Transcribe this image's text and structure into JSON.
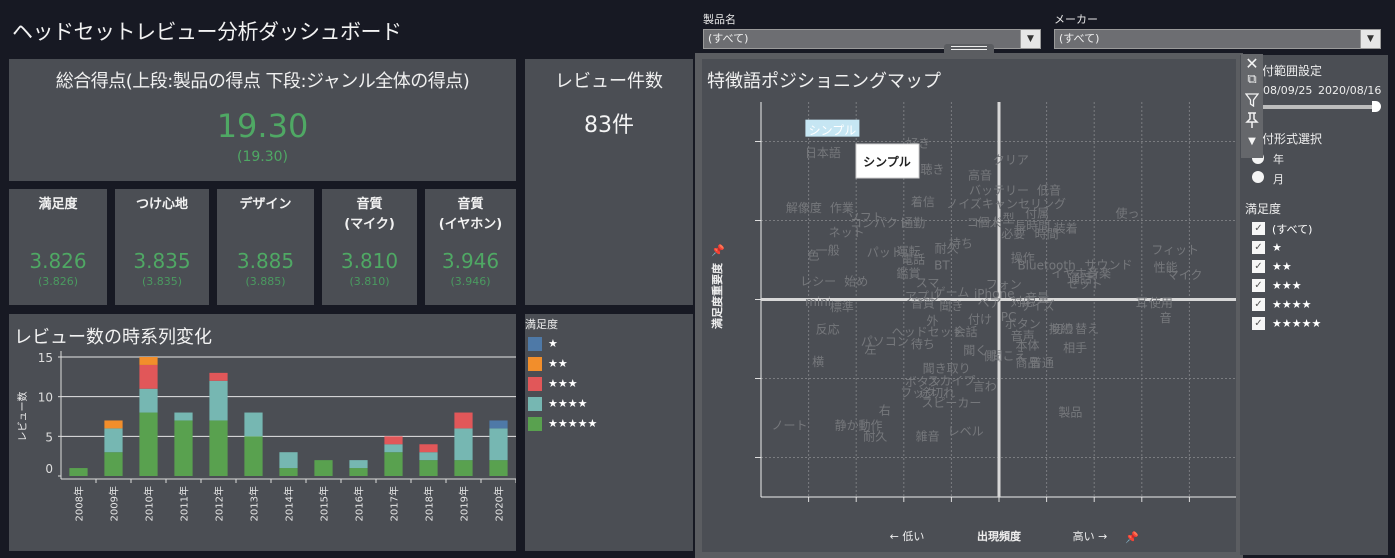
{
  "app": {
    "title": "ヘッドセットレビュー分析ダッシュボード"
  },
  "total_score": {
    "title": "総合得点(上段:製品の得点 下段:ジャンル全体の得点)",
    "product_score": "19.30",
    "genre_score": "(19.30)"
  },
  "review_count": {
    "title": "レビュー件数",
    "value": "83件"
  },
  "metrics": [
    {
      "label": "満足度",
      "value": "3.826",
      "genre": "(3.826)"
    },
    {
      "label": "つけ心地",
      "value": "3.835",
      "genre": "(3.835)"
    },
    {
      "label": "デザイン",
      "value": "3.885",
      "genre": "(3.885)"
    },
    {
      "label": "音質\n(マイク)",
      "value": "3.810",
      "genre": "(3.810)"
    },
    {
      "label": "音質\n(イヤホン)",
      "value": "3.946",
      "genre": "(3.946)"
    }
  ],
  "filters": {
    "product": {
      "label": "製品名",
      "value": "(すべて)"
    },
    "maker": {
      "label": "メーカー",
      "value": "(すべて)"
    }
  },
  "colors": {
    "star1": "#4e79a7",
    "star2": "#f28e2b",
    "star3": "#e15759",
    "star4": "#76b7b2",
    "star5": "#59a14f",
    "score_green": "#4fa864"
  },
  "legend": {
    "title": "満足度",
    "items": [
      {
        "label": "★",
        "key": "star1"
      },
      {
        "label": "★★",
        "key": "star2"
      },
      {
        "label": "★★★",
        "key": "star3"
      },
      {
        "label": "★★★★",
        "key": "star4"
      },
      {
        "label": "★★★★★",
        "key": "star5"
      }
    ]
  },
  "chart_data": [
    {
      "type": "bar",
      "stacked": true,
      "title": "レビュー数の時系列変化",
      "xlabel": "",
      "ylabel": "レビュー数",
      "ylim": [
        0,
        15
      ],
      "yticks": [
        0,
        5,
        10,
        15
      ],
      "grid": true,
      "categories": [
        "2008年",
        "2009年",
        "2010年",
        "2011年",
        "2012年",
        "2013年",
        "2014年",
        "2015年",
        "2016年",
        "2017年",
        "2018年",
        "2019年",
        "2020年"
      ],
      "series": [
        {
          "name": "★★★★★",
          "key": "star5",
          "values": [
            1,
            3,
            8,
            7,
            7,
            5,
            1,
            2,
            1,
            3,
            2,
            2,
            2
          ]
        },
        {
          "name": "★★★★",
          "key": "star4",
          "values": [
            0,
            3,
            3,
            1,
            5,
            3,
            2,
            0,
            1,
            1,
            1,
            4,
            4
          ]
        },
        {
          "name": "★★★",
          "key": "star3",
          "values": [
            0,
            0,
            3,
            0,
            1,
            0,
            0,
            0,
            0,
            1,
            1,
            2,
            0
          ]
        },
        {
          "name": "★★",
          "key": "star2",
          "values": [
            0,
            1,
            1,
            0,
            0,
            0,
            0,
            0,
            0,
            0,
            0,
            0,
            0
          ]
        },
        {
          "name": "★",
          "key": "star1",
          "values": [
            0,
            0,
            0,
            0,
            0,
            0,
            0,
            0,
            0,
            0,
            0,
            0,
            1
          ]
        }
      ],
      "legend": "right"
    },
    {
      "type": "scatter",
      "title": "特徴語ポジショニングマップ",
      "xlabel": "出現頻度",
      "xlabel_low": "← 低い",
      "xlabel_high": "高い →",
      "ylabel": "満足度重要度",
      "xlim": [
        -5,
        5
      ],
      "ylim": [
        -2.5,
        2.5
      ],
      "grid": true,
      "highlighted": "シンプル",
      "tooltip": "シンプル",
      "points": [
        {
          "w": "シンプル",
          "x": -3.5,
          "y": 2.15
        },
        {
          "w": "好き",
          "x": -1.7,
          "y": 1.99
        },
        {
          "w": "日本語",
          "x": -3.7,
          "y": 1.87
        },
        {
          "w": "聴き",
          "x": -1.4,
          "y": 1.66
        },
        {
          "w": "クリア",
          "x": 0.25,
          "y": 1.78
        },
        {
          "w": "高音",
          "x": -0.4,
          "y": 1.58
        },
        {
          "w": "バッテリー",
          "x": 0.0,
          "y": 1.39
        },
        {
          "w": "低音",
          "x": 1.05,
          "y": 1.39
        },
        {
          "w": "着信",
          "x": -1.6,
          "y": 1.25
        },
        {
          "w": "ノイズキャンセリング",
          "x": 0.15,
          "y": 1.22
        },
        {
          "w": "解像度",
          "x": -4.1,
          "y": 1.17
        },
        {
          "w": "作業",
          "x": -3.3,
          "y": 1.17
        },
        {
          "w": "付属",
          "x": 0.8,
          "y": 1.1
        },
        {
          "w": "使っ",
          "x": 2.7,
          "y": 1.1
        },
        {
          "w": "ソフト",
          "x": -2.8,
          "y": 1.05
        },
        {
          "w": "コンパクト",
          "x": -2.5,
          "y": 0.98
        },
        {
          "w": "通勤",
          "x": -1.8,
          "y": 0.98
        },
        {
          "w": "コード",
          "x": -0.3,
          "y": 0.99
        },
        {
          "w": "個人",
          "x": -0.2,
          "y": 0.99
        },
        {
          "w": "型",
          "x": 0.2,
          "y": 1.04
        },
        {
          "w": "長時間",
          "x": 0.7,
          "y": 0.94
        },
        {
          "w": "装着",
          "x": 1.4,
          "y": 0.91
        },
        {
          "w": "必要",
          "x": 0.3,
          "y": 0.84
        },
        {
          "w": "時間",
          "x": 1.0,
          "y": 0.84
        },
        {
          "w": "ネット",
          "x": -3.2,
          "y": 0.86
        },
        {
          "w": "一般",
          "x": -3.6,
          "y": 0.63
        },
        {
          "w": "色",
          "x": -3.9,
          "y": 0.57
        },
        {
          "w": "パッド",
          "x": -2.4,
          "y": 0.61
        },
        {
          "w": "運転",
          "x": -1.9,
          "y": 0.62
        },
        {
          "w": "持ち",
          "x": -0.8,
          "y": 0.72
        },
        {
          "w": "耐久",
          "x": -1.1,
          "y": 0.66
        },
        {
          "w": "電話",
          "x": -1.8,
          "y": 0.52
        },
        {
          "w": "BT",
          "x": -1.2,
          "y": 0.44
        },
        {
          "w": "フィット",
          "x": 3.7,
          "y": 0.64
        },
        {
          "w": "操作",
          "x": 0.5,
          "y": 0.54
        },
        {
          "w": "Bluetooth",
          "x": 1.0,
          "y": 0.44
        },
        {
          "w": "サウンド",
          "x": 2.3,
          "y": 0.45
        },
        {
          "w": "音楽",
          "x": 2.1,
          "y": 0.34
        },
        {
          "w": "性能",
          "x": 3.5,
          "y": 0.42
        },
        {
          "w": "マイク",
          "x": 3.9,
          "y": 0.32
        },
        {
          "w": "イヤホン",
          "x": 1.6,
          "y": 0.34
        },
        {
          "w": "通話",
          "x": 1.7,
          "y": 0.28
        },
        {
          "w": "セット",
          "x": 1.8,
          "y": 0.21
        },
        {
          "w": "鑑賞",
          "x": -1.9,
          "y": 0.34
        },
        {
          "w": "レシー",
          "x": -3.8,
          "y": 0.24
        },
        {
          "w": "始め",
          "x": -3.0,
          "y": 0.24
        },
        {
          "w": "スマ",
          "x": -1.5,
          "y": 0.22
        },
        {
          "w": "ゲーム",
          "x": -1.0,
          "y": 0.1
        },
        {
          "w": "アプリ",
          "x": -1.6,
          "y": 0.05
        },
        {
          "w": "フォン",
          "x": 0.1,
          "y": 0.2
        },
        {
          "w": "iPhone",
          "x": -0.1,
          "y": 0.08
        },
        {
          "w": "音量",
          "x": 0.8,
          "y": 0.03
        },
        {
          "w": "mini",
          "x": -3.8,
          "y": -0.02
        },
        {
          "w": "標準",
          "x": -3.3,
          "y": -0.08
        },
        {
          "w": "音質",
          "x": -1.6,
          "y": -0.04
        },
        {
          "w": "聞き",
          "x": -1.0,
          "y": -0.07
        },
        {
          "w": "ペア",
          "x": -0.2,
          "y": -0.03
        },
        {
          "w": "対応",
          "x": 0.5,
          "y": -0.02
        },
        {
          "w": "サイズ",
          "x": 0.8,
          "y": -0.07
        },
        {
          "w": "耳",
          "x": 3.0,
          "y": -0.03
        },
        {
          "w": "使用",
          "x": 3.4,
          "y": -0.03
        },
        {
          "w": "音",
          "x": 3.5,
          "y": -0.22
        },
        {
          "w": "反応",
          "x": -3.6,
          "y": -0.37
        },
        {
          "w": "外",
          "x": -1.4,
          "y": -0.26
        },
        {
          "w": "付け",
          "x": -0.4,
          "y": -0.24
        },
        {
          "w": "PC",
          "x": 0.2,
          "y": -0.21
        },
        {
          "w": "ボタン",
          "x": 0.5,
          "y": -0.3
        },
        {
          "w": "音声",
          "x": 0.5,
          "y": -0.45
        },
        {
          "w": "会話",
          "x": -0.7,
          "y": -0.4
        },
        {
          "w": "接続",
          "x": 1.3,
          "y": -0.36
        },
        {
          "w": "切り替え",
          "x": 1.6,
          "y": -0.36
        },
        {
          "w": "パソコン",
          "x": -2.4,
          "y": -0.52
        },
        {
          "w": "ヘッドセット",
          "x": -1.5,
          "y": -0.4
        },
        {
          "w": "待ち",
          "x": -1.6,
          "y": -0.55
        },
        {
          "w": "左",
          "x": -2.7,
          "y": -0.62
        },
        {
          "w": "本体",
          "x": 0.6,
          "y": -0.57
        },
        {
          "w": "相手",
          "x": 1.6,
          "y": -0.6
        },
        {
          "w": "聞こえ",
          "x": 0.2,
          "y": -0.7
        },
        {
          "w": "聞く",
          "x": -0.5,
          "y": -0.63
        },
        {
          "w": "側",
          "x": -0.2,
          "y": -0.7
        },
        {
          "w": "商品",
          "x": 0.6,
          "y": -0.79
        },
        {
          "w": "普通",
          "x": 0.9,
          "y": -0.79
        },
        {
          "w": "横",
          "x": -3.8,
          "y": -0.78
        },
        {
          "w": "聞き取り",
          "x": -1.1,
          "y": -0.86
        },
        {
          "w": "ボタン",
          "x": -1.6,
          "y": -1.03
        },
        {
          "w": "スカイプ",
          "x": -1.0,
          "y": -1.02
        },
        {
          "w": "言わ",
          "x": -0.3,
          "y": -1.09
        },
        {
          "w": "フック",
          "x": -1.7,
          "y": -1.17
        },
        {
          "w": "途切れ",
          "x": -1.3,
          "y": -1.17
        },
        {
          "w": "スピーカー",
          "x": -1.0,
          "y": -1.3
        },
        {
          "w": "右",
          "x": -2.4,
          "y": -1.39
        },
        {
          "w": "製品",
          "x": 1.5,
          "y": -1.42
        },
        {
          "w": "ノート",
          "x": -4.4,
          "y": -1.58
        },
        {
          "w": "静か",
          "x": -3.2,
          "y": -1.58
        },
        {
          "w": "動作",
          "x": -2.7,
          "y": -1.58
        },
        {
          "w": "耐久",
          "x": -2.6,
          "y": -1.72
        },
        {
          "w": "雑音",
          "x": -1.5,
          "y": -1.72
        },
        {
          "w": "レベル",
          "x": -0.7,
          "y": -1.66
        }
      ]
    }
  ],
  "right_panel": {
    "date_range_title": "付範囲設定",
    "date_start": "08/09/25",
    "date_end": "2020/08/16",
    "slider_value": 1.0,
    "date_format_title": "付形式選択",
    "date_format_options": [
      "年",
      "月"
    ],
    "date_format_selected": "年",
    "satisfaction_title": "満足度",
    "satisfaction_options": [
      {
        "label": "(すべて)",
        "checked": true
      },
      {
        "label": "★",
        "checked": true
      },
      {
        "label": "★★",
        "checked": true
      },
      {
        "label": "★★★",
        "checked": true
      },
      {
        "label": "★★★★",
        "checked": true
      },
      {
        "label": "★★★★★",
        "checked": true
      }
    ]
  },
  "toolbar": {
    "icons": [
      "close-icon",
      "popout-icon",
      "filter-icon",
      "pin-icon",
      "more-icon"
    ]
  }
}
